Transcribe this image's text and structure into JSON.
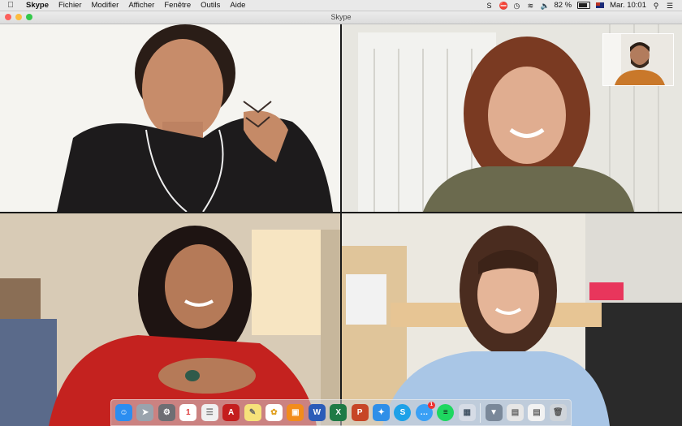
{
  "menubar": {
    "app_name": "Skype",
    "items": [
      "Fichier",
      "Modifier",
      "Afficher",
      "Fenêtre",
      "Outils",
      "Aide"
    ],
    "battery": "82 %",
    "clock": "Mar. 10:01"
  },
  "window": {
    "title": "Skype"
  },
  "participants": [
    {
      "name": "participant-top-left"
    },
    {
      "name": "participant-top-right"
    },
    {
      "name": "participant-bottom-left"
    },
    {
      "name": "participant-bottom-right"
    }
  ],
  "dock": {
    "calendar_day": "1",
    "skype_badge": "1",
    "apps": [
      "finder",
      "launchpad",
      "system-preferences",
      "calendar",
      "notes",
      "acrobat",
      "stickies",
      "photos",
      "books",
      "word",
      "excel",
      "powerpoint",
      "safari",
      "skype",
      "messages",
      "spotify",
      "preview"
    ],
    "colors": {
      "finder": "#2c8df0",
      "word": "#2b5cb8",
      "excel": "#1f7a45",
      "powerpoint": "#c74626",
      "skype": "#1da1e8",
      "spotify": "#1ed760",
      "acrobat": "#c41e1e"
    }
  }
}
